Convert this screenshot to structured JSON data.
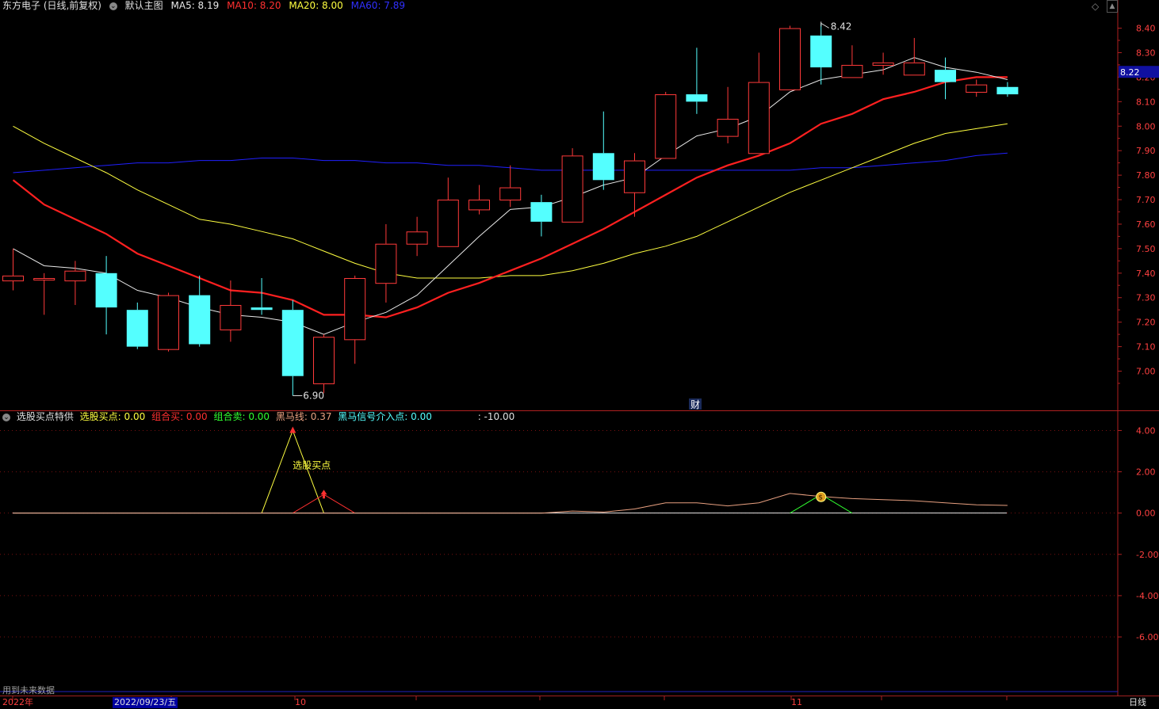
{
  "colors": {
    "bg": "#000000",
    "up": "#ff3a3a",
    "down": "#54ffff",
    "ma5": "#e8e8e8",
    "ma10": "#ff2020",
    "ma20": "#ffff40",
    "ma60": "#2020ff",
    "grid": "#7a1010"
  },
  "header": {
    "stock": "东方电子 (日线,前复权)",
    "template": "默认主图",
    "ma5_label": "MA5: 8.19",
    "ma10_label": "MA10: 8.20",
    "ma20_label": "MA20: 8.00",
    "ma60_label": "MA60: 7.89"
  },
  "indicator_header": {
    "name": "选股买点特供",
    "xgmd": "选股买点: 0.00",
    "zhm": "组合买: 0.00",
    "zhmai": "组合卖: 0.00",
    "hmx": "黑马线: 0.37",
    "hmxh": "黑马信号介入点: 0.00",
    "extra": ": -10.00"
  },
  "annotations": {
    "high_label": "8.42",
    "low_label": "6.90",
    "cai": "财",
    "buy_point": "选股买点",
    "price_tag": "8.22",
    "future_data": "用到未来数据",
    "money_icon": "money-bag-icon"
  },
  "bottom": {
    "year": "2022年",
    "date": "2022/09/23/五",
    "m10": "10",
    "m11": "11",
    "period": "日线"
  },
  "chart_data": [
    {
      "type": "candlestick",
      "title": "默认主图",
      "ylim": [
        6.84,
        8.46
      ],
      "y_ticks": [
        "8.40",
        "8.30",
        "8.20",
        "8.10",
        "8.00",
        "7.90",
        "7.80",
        "7.70",
        "7.60",
        "7.50",
        "7.40",
        "7.30",
        "7.20",
        "7.10",
        "7.00"
      ],
      "candles": [
        {
          "o": 7.37,
          "c": 7.39,
          "h": 7.5,
          "l": 7.33
        },
        {
          "o": 7.38,
          "c": 7.38,
          "h": 7.4,
          "l": 7.23
        },
        {
          "o": 7.37,
          "c": 7.41,
          "h": 7.45,
          "l": 7.27
        },
        {
          "o": 7.4,
          "c": 7.26,
          "h": 7.47,
          "l": 7.15
        },
        {
          "o": 7.25,
          "c": 7.1,
          "h": 7.28,
          "l": 7.09
        },
        {
          "o": 7.09,
          "c": 7.31,
          "h": 7.32,
          "l": 7.08
        },
        {
          "o": 7.31,
          "c": 7.11,
          "h": 7.39,
          "l": 7.1
        },
        {
          "o": 7.17,
          "c": 7.27,
          "h": 7.37,
          "l": 7.12
        },
        {
          "o": 7.26,
          "c": 7.25,
          "h": 7.38,
          "l": 7.23
        },
        {
          "o": 7.25,
          "c": 6.98,
          "h": 7.29,
          "l": 6.9
        },
        {
          "o": 6.95,
          "c": 7.14,
          "h": 7.15,
          "l": 6.91
        },
        {
          "o": 7.13,
          "c": 7.38,
          "h": 7.39,
          "l": 7.03
        },
        {
          "o": 7.36,
          "c": 7.52,
          "h": 7.6,
          "l": 7.28
        },
        {
          "o": 7.52,
          "c": 7.57,
          "h": 7.63,
          "l": 7.47
        },
        {
          "o": 7.51,
          "c": 7.7,
          "h": 7.79,
          "l": 7.51
        },
        {
          "o": 7.66,
          "c": 7.7,
          "h": 7.76,
          "l": 7.64
        },
        {
          "o": 7.7,
          "c": 7.75,
          "h": 7.84,
          "l": 7.67
        },
        {
          "o": 7.69,
          "c": 7.61,
          "h": 7.72,
          "l": 7.55
        },
        {
          "o": 7.61,
          "c": 7.88,
          "h": 7.91,
          "l": 7.61
        },
        {
          "o": 7.89,
          "c": 7.78,
          "h": 8.06,
          "l": 7.74
        },
        {
          "o": 7.73,
          "c": 7.86,
          "h": 7.89,
          "l": 7.63
        },
        {
          "o": 7.87,
          "c": 8.13,
          "h": 8.14,
          "l": 7.87
        },
        {
          "o": 8.13,
          "c": 8.1,
          "h": 8.32,
          "l": 8.05
        },
        {
          "o": 7.96,
          "c": 8.03,
          "h": 8.16,
          "l": 7.93
        },
        {
          "o": 7.89,
          "c": 8.18,
          "h": 8.3,
          "l": 7.89
        },
        {
          "o": 8.15,
          "c": 8.4,
          "h": 8.41,
          "l": 8.15
        },
        {
          "o": 8.37,
          "c": 8.24,
          "h": 8.42,
          "l": 8.17
        },
        {
          "o": 8.2,
          "c": 8.25,
          "h": 8.33,
          "l": 8.2
        },
        {
          "o": 8.25,
          "c": 8.26,
          "h": 8.3,
          "l": 8.21
        },
        {
          "o": 8.21,
          "c": 8.26,
          "h": 8.36,
          "l": 8.21
        },
        {
          "o": 8.23,
          "c": 8.18,
          "h": 8.28,
          "l": 8.11
        },
        {
          "o": 8.14,
          "c": 8.17,
          "h": 8.19,
          "l": 8.12
        },
        {
          "o": 8.16,
          "c": 8.13,
          "h": 8.18,
          "l": 8.12
        }
      ],
      "ma5": [
        7.5,
        7.43,
        7.42,
        7.4,
        7.33,
        7.3,
        7.26,
        7.23,
        7.22,
        7.2,
        7.15,
        7.2,
        7.24,
        7.31,
        7.43,
        7.55,
        7.66,
        7.67,
        7.71,
        7.76,
        7.79,
        7.88,
        7.96,
        7.99,
        8.04,
        8.14,
        8.19,
        8.21,
        8.23,
        8.28,
        8.24,
        8.22,
        8.19
      ],
      "ma10": [
        7.78,
        7.68,
        7.62,
        7.56,
        7.48,
        7.43,
        7.38,
        7.33,
        7.32,
        7.29,
        7.23,
        7.23,
        7.22,
        7.26,
        7.32,
        7.36,
        7.41,
        7.46,
        7.52,
        7.58,
        7.65,
        7.72,
        7.79,
        7.84,
        7.88,
        7.93,
        8.01,
        8.05,
        8.11,
        8.14,
        8.18,
        8.2,
        8.2
      ],
      "ma20": [
        8.0,
        7.93,
        7.87,
        7.81,
        7.74,
        7.68,
        7.62,
        7.6,
        7.57,
        7.54,
        7.49,
        7.44,
        7.4,
        7.38,
        7.38,
        7.38,
        7.39,
        7.39,
        7.41,
        7.44,
        7.48,
        7.51,
        7.55,
        7.61,
        7.67,
        7.73,
        7.78,
        7.83,
        7.88,
        7.93,
        7.97,
        7.99,
        8.01
      ],
      "ma60": [
        7.81,
        7.82,
        7.83,
        7.84,
        7.85,
        7.85,
        7.86,
        7.86,
        7.87,
        7.87,
        7.86,
        7.86,
        7.85,
        7.85,
        7.84,
        7.84,
        7.83,
        7.82,
        7.82,
        7.82,
        7.82,
        7.82,
        7.82,
        7.82,
        7.82,
        7.82,
        7.83,
        7.83,
        7.84,
        7.85,
        7.86,
        7.88,
        7.89
      ]
    },
    {
      "type": "line",
      "title": "选股买点特供",
      "ylim": [
        -8.8,
        4.9
      ],
      "y_ticks": [
        "4.00",
        "2.00",
        "0.00",
        "-2.00",
        "-4.00",
        "-6.00"
      ],
      "series": [
        {
          "name": "选股买点",
          "values": [
            0,
            0,
            0,
            0,
            0,
            0,
            0,
            0,
            0,
            4,
            0,
            0,
            0,
            0,
            0,
            0,
            0,
            0,
            0,
            0,
            0,
            0,
            0,
            0,
            0,
            0,
            0,
            0,
            0,
            0,
            0,
            0,
            0
          ]
        },
        {
          "name": "组合买",
          "values": [
            0,
            0,
            0,
            0,
            0,
            0,
            0,
            0,
            0,
            0,
            0.9,
            0,
            0,
            0,
            0,
            0,
            0,
            0,
            0,
            0,
            0,
            0,
            0,
            0,
            0,
            0,
            0,
            0,
            0,
            0,
            0,
            0,
            0
          ]
        },
        {
          "name": "组合卖",
          "values": [
            0,
            0,
            0,
            0,
            0,
            0,
            0,
            0,
            0,
            0,
            0,
            0,
            0,
            0,
            0,
            0,
            0,
            0,
            0,
            0,
            0,
            0,
            0,
            0,
            0,
            0,
            0.9,
            0,
            0,
            0,
            0,
            0,
            0
          ]
        },
        {
          "name": "黑马线",
          "values": [
            0,
            0,
            0,
            0,
            0,
            0,
            0,
            0,
            0,
            0,
            0,
            0,
            0,
            0,
            0,
            0,
            0,
            0,
            0.1,
            0.05,
            0.2,
            0.5,
            0.5,
            0.35,
            0.5,
            0.95,
            0.8,
            0.7,
            0.65,
            0.6,
            0.5,
            0.4,
            0.37
          ]
        }
      ]
    }
  ]
}
